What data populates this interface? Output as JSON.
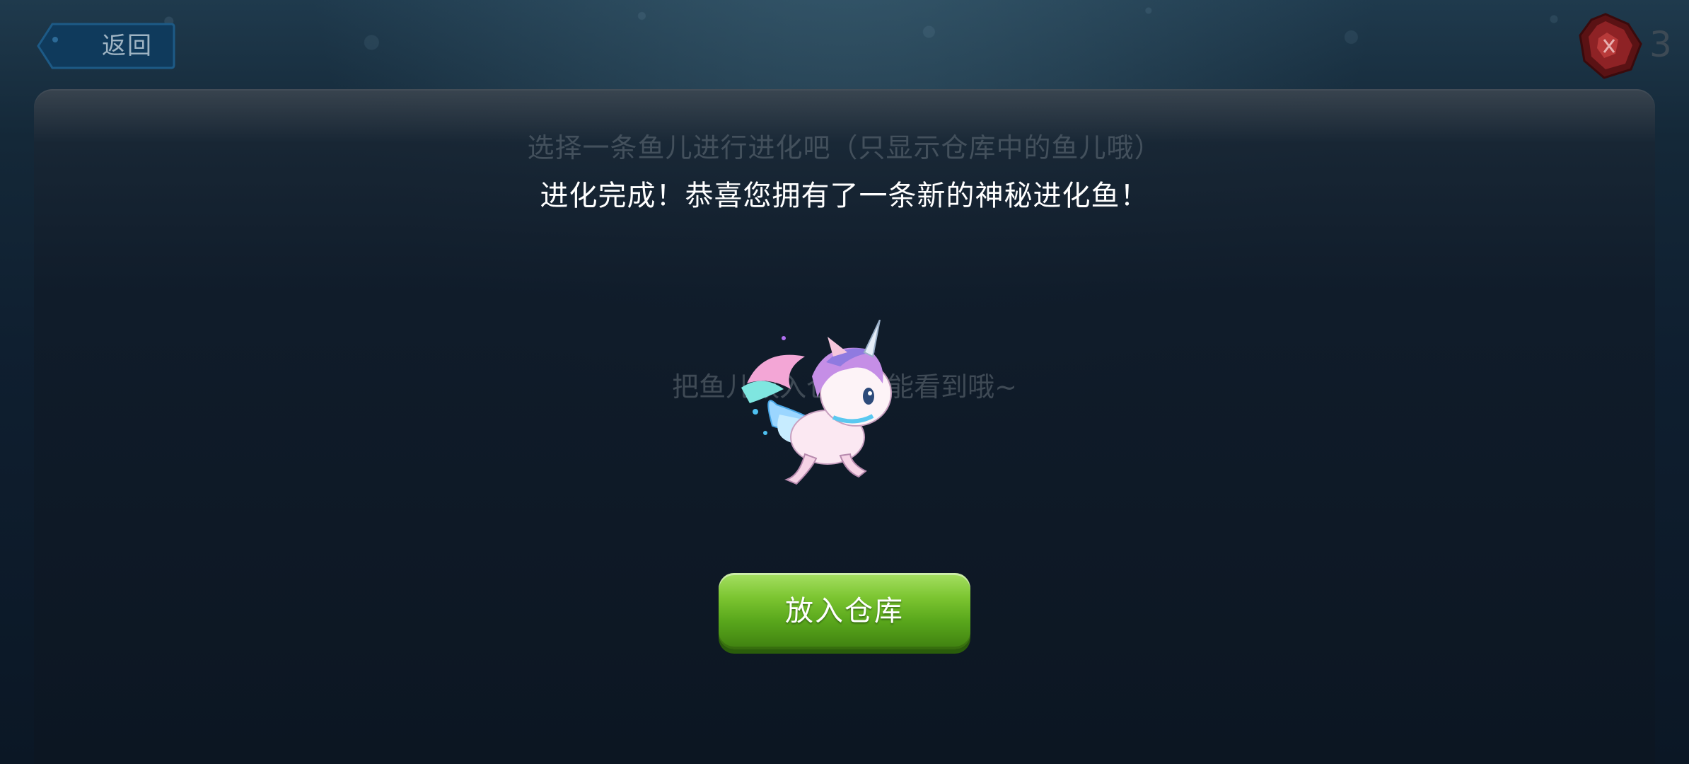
{
  "header": {
    "back_label": "返回",
    "gem_count": "3",
    "gem_icon": "red-gem-icon"
  },
  "panel": {
    "select_hint": "选择一条鱼儿进行进化吧（只显示仓库中的鱼儿哦）",
    "result_message": "进化完成！恭喜您拥有了一条新的神秘进化鱼！",
    "empty_hint": "把鱼儿放入仓库就能看到哦~",
    "new_fish_image": "unicorn-pegasus-fish"
  },
  "actions": {
    "store_label": "放入仓库",
    "store_color": "#6cbb28"
  }
}
